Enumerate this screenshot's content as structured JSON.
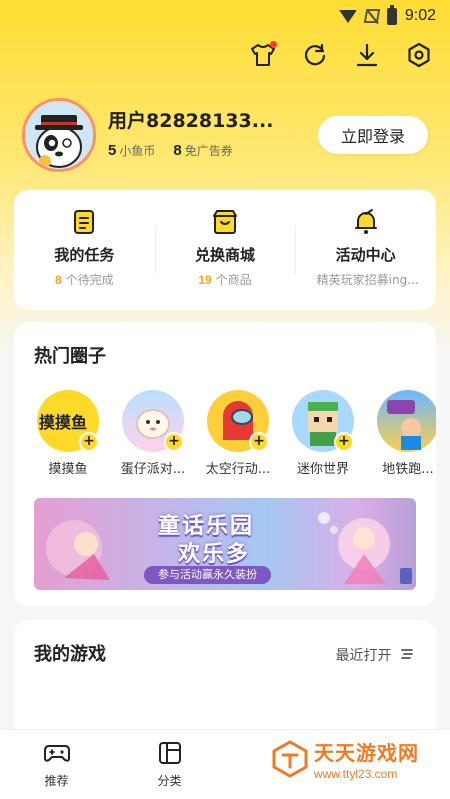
{
  "status_bar": {
    "time": "9:02"
  },
  "toolbar": {
    "icons": [
      "tshirt-icon",
      "refresh-icon",
      "download-icon",
      "settings-icon"
    ]
  },
  "profile": {
    "username": "用户82828133...",
    "coins_value": "5",
    "coins_label": "小鱼币",
    "coupons_value": "8",
    "coupons_label": "免广告券",
    "login_label": "立即登录"
  },
  "quick": [
    {
      "title": "我的任务",
      "count": "8",
      "sub": "个待完成",
      "icon": "task-icon"
    },
    {
      "title": "兑换商城",
      "count": "19",
      "sub": "个商品",
      "icon": "shop-icon"
    },
    {
      "title": "活动中心",
      "count": "",
      "sub": "精英玩家招募ing...",
      "icon": "bell-icon"
    }
  ],
  "circles": {
    "title": "热门圈子",
    "items": [
      {
        "label": "摸摸鱼",
        "logo_text": "摸摸鱼"
      },
      {
        "label": "蛋仔派对..."
      },
      {
        "label": "太空行动..."
      },
      {
        "label": "迷你世界"
      },
      {
        "label": "地铁跑..."
      }
    ],
    "banner": {
      "title1": "童话乐园",
      "title2": "欢乐多",
      "sub": "参与活动赢永久装扮"
    }
  },
  "games": {
    "title": "我的游戏",
    "recent": "最近打开"
  },
  "nav": [
    {
      "label": "推荐",
      "icon": "gamepad-icon"
    },
    {
      "label": "分类",
      "icon": "category-icon"
    }
  ],
  "watermark": {
    "text": "天天游戏网",
    "url": "www.ttyl23.com"
  },
  "colors": {
    "accent": "#ffd92a",
    "highlight": "#f5a623",
    "background": "#f6f6f6"
  }
}
